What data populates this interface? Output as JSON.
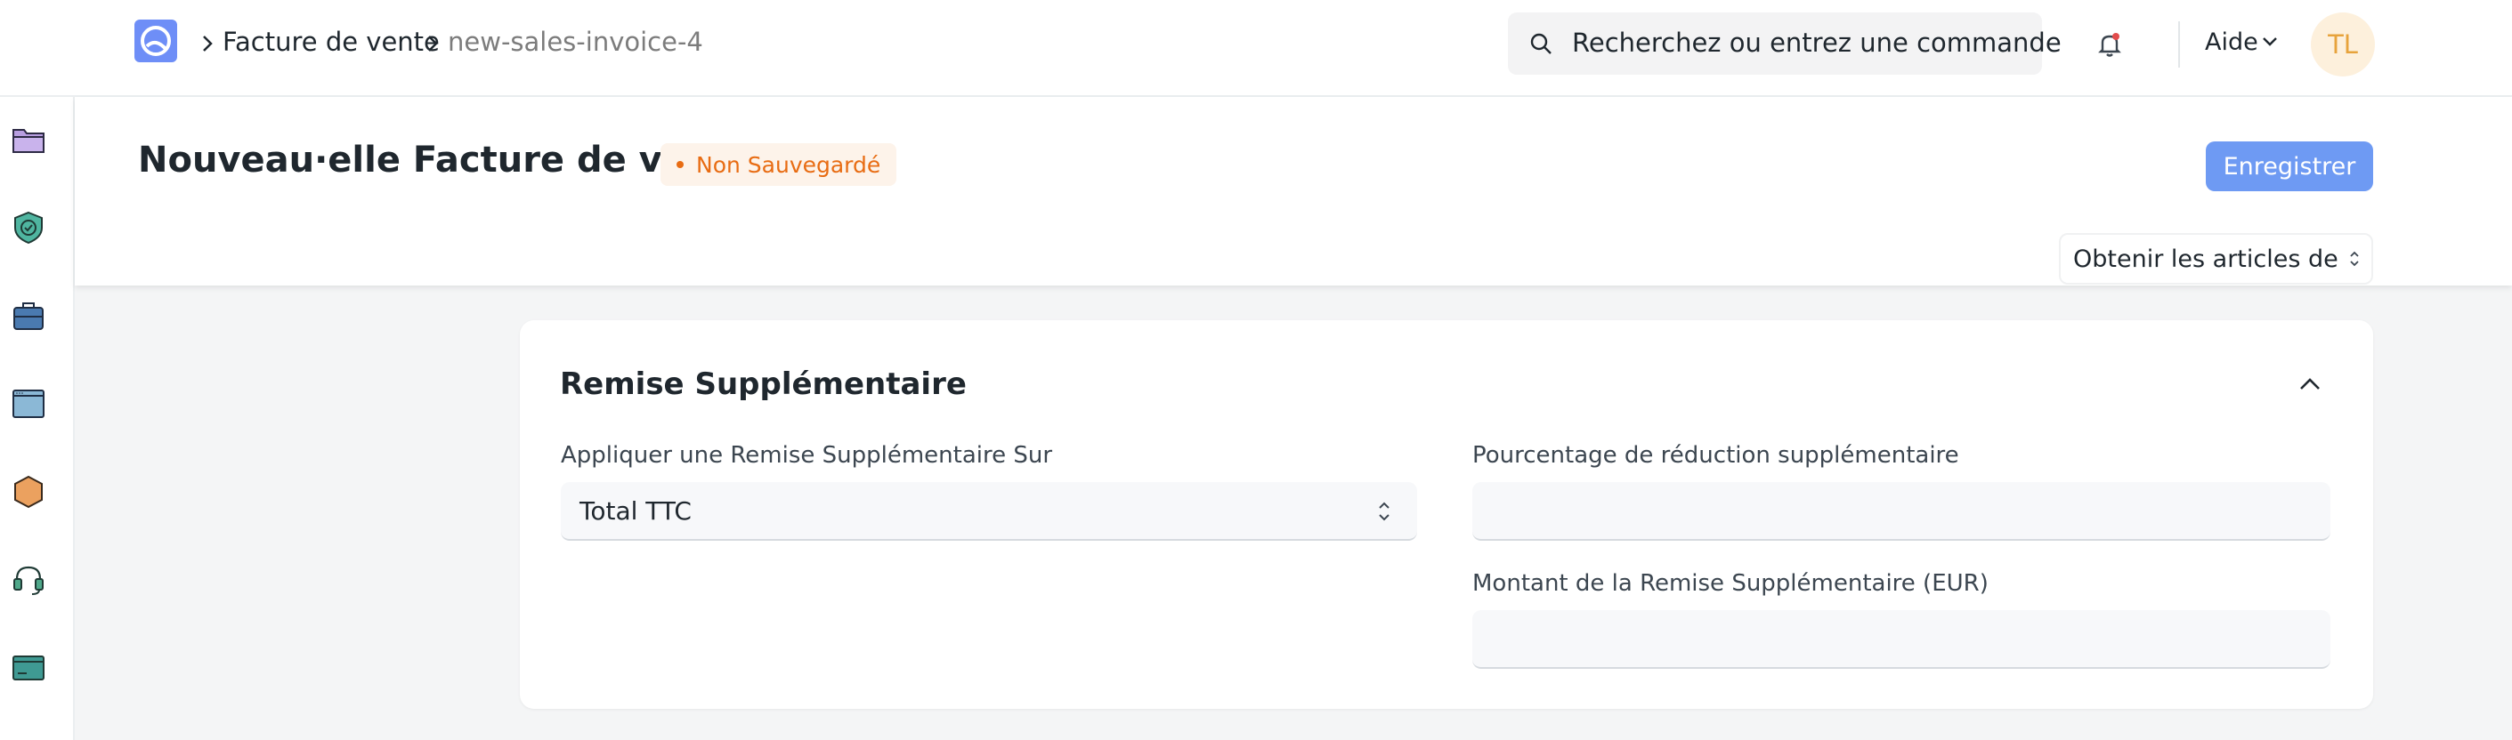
{
  "header": {
    "breadcrumbs": [
      "Facture de vente",
      "new-sales-invoice-4"
    ],
    "search_placeholder": "Recherchez ou entrez une commande",
    "help_label": "Aide",
    "avatar_initials": "TL"
  },
  "page": {
    "title": "Nouveau·elle Facture de vente",
    "status_badge": "Non Sauvegardé",
    "save_label": "Enregistrer",
    "get_items_label": "Obtenir les articles de"
  },
  "sidebar": {
    "icons": [
      "folder-icon",
      "shield-check-icon",
      "briefcase-icon",
      "window-icon",
      "hexagon-icon",
      "headset-icon",
      "card-icon"
    ]
  },
  "section": {
    "title": "Remise Supplémentaire",
    "apply_on_label": "Appliquer une Remise Supplémentaire Sur",
    "apply_on_value": "Total TTC",
    "percentage_label": "Pourcentage de réduction supplémentaire",
    "percentage_value": "",
    "amount_label": "Montant de la Remise Supplémentaire (EUR)",
    "amount_value": ""
  },
  "colors": {
    "primary": "#6e9af3",
    "badge_text": "#e86c13",
    "badge_bg": "#fdf3ea",
    "avatar_bg": "#fdf0dc",
    "avatar_text": "#e7a33c"
  }
}
